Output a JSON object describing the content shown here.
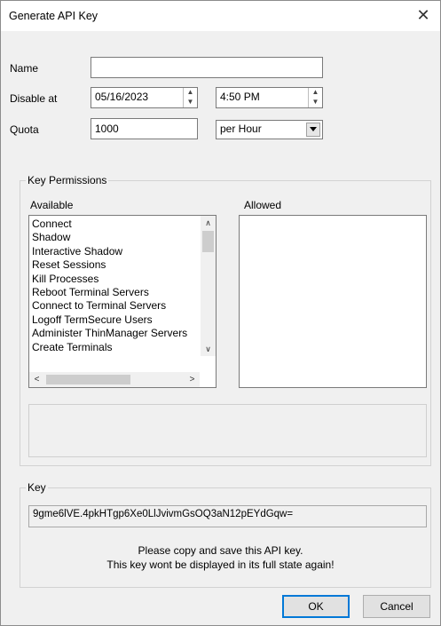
{
  "window": {
    "title": "Generate API Key",
    "close_glyph": "✕"
  },
  "form": {
    "name_label": "Name",
    "name_value": "",
    "disable_label": "Disable at",
    "date_value": "05/16/2023",
    "time_value": "4:50 PM",
    "quota_label": "Quota",
    "quota_value": "1000",
    "period_value": "per Hour"
  },
  "permissions": {
    "group_label": "Key Permissions",
    "available_label": "Available",
    "allowed_label": "Allowed",
    "available_items": [
      "Connect",
      "Shadow",
      "Interactive Shadow",
      "Reset Sessions",
      "Kill Processes",
      "Reboot Terminal Servers",
      "Connect to Terminal Servers",
      "Logoff TermSecure Users",
      "Administer ThinManager Servers",
      "Create Terminals"
    ]
  },
  "key": {
    "group_label": "Key",
    "value": "9gme6lVE.4pkHTgp6Xe0LlJvivmGsOQ3aN12pEYdGqw=",
    "note_line1": "Please copy and save this API key.",
    "note_line2": "This key wont be displayed in its full state again!"
  },
  "buttons": {
    "ok": "OK",
    "cancel": "Cancel"
  }
}
